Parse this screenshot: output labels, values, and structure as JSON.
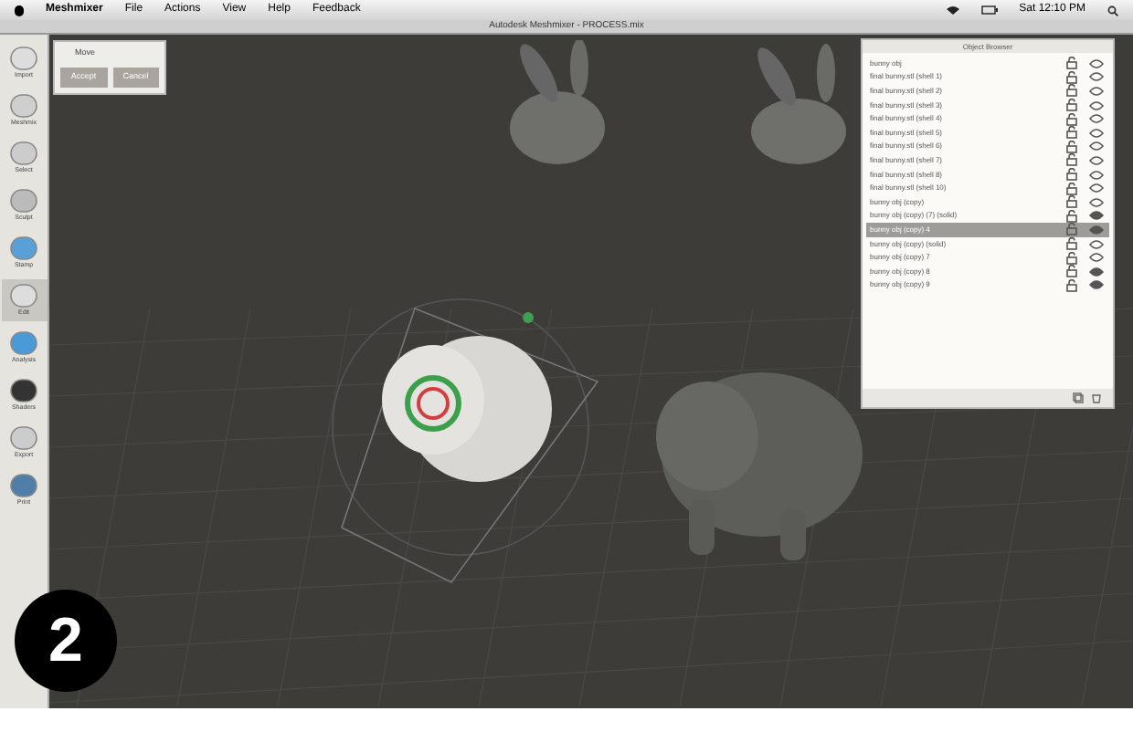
{
  "menu_bar": {
    "app": "Meshmixer",
    "items": [
      "File",
      "Actions",
      "View",
      "Help",
      "Feedback"
    ],
    "clock": "Sat 12:10 PM"
  },
  "window": {
    "title": "Autodesk Meshmixer - PROCESS.mix"
  },
  "sidebar": {
    "items": [
      {
        "label": "Import",
        "selected": false
      },
      {
        "label": "Meshmix",
        "selected": false
      },
      {
        "label": "Select",
        "selected": false
      },
      {
        "label": "Sculpt",
        "selected": false
      },
      {
        "label": "Stamp",
        "selected": false
      },
      {
        "label": "Edit",
        "selected": true
      },
      {
        "label": "Analysis",
        "selected": false
      },
      {
        "label": "Shaders",
        "selected": false
      },
      {
        "label": "Export",
        "selected": false
      },
      {
        "label": "Print",
        "selected": false
      }
    ]
  },
  "tool_panel": {
    "title": "Move",
    "buttons": [
      "Accept",
      "Cancel"
    ]
  },
  "object_browser": {
    "title": "Object Browser",
    "items": [
      {
        "name": "bunny obj",
        "selected": false,
        "visible": false
      },
      {
        "name": "final bunny.stl (shell 1)",
        "selected": false,
        "visible": false
      },
      {
        "name": "final bunny.stl (shell 2)",
        "selected": false,
        "visible": false
      },
      {
        "name": "final bunny.stl (shell 3)",
        "selected": false,
        "visible": false
      },
      {
        "name": "final bunny.stl (shell 4)",
        "selected": false,
        "visible": false
      },
      {
        "name": "final bunny.stl (shell 5)",
        "selected": false,
        "visible": false
      },
      {
        "name": "final bunny.stl (shell 6)",
        "selected": false,
        "visible": false
      },
      {
        "name": "final bunny.stl (shell 7)",
        "selected": false,
        "visible": false
      },
      {
        "name": "final bunny.stl (shell 8)",
        "selected": false,
        "visible": false
      },
      {
        "name": "final bunny.stl (shell 10)",
        "selected": false,
        "visible": false
      },
      {
        "name": "bunny obj (copy)",
        "selected": false,
        "visible": false
      },
      {
        "name": "bunny obj (copy) (7) (solid)",
        "selected": false,
        "visible": true
      },
      {
        "name": "bunny obj (copy) 4",
        "selected": true,
        "visible": true
      },
      {
        "name": "bunny obj (copy) (solid)",
        "selected": false,
        "visible": false
      },
      {
        "name": "bunny obj (copy) 7",
        "selected": false,
        "visible": false
      },
      {
        "name": "bunny obj (copy) 8",
        "selected": false,
        "visible": true
      },
      {
        "name": "bunny obj (copy) 9",
        "selected": false,
        "visible": true
      }
    ]
  },
  "step_badge": "2"
}
